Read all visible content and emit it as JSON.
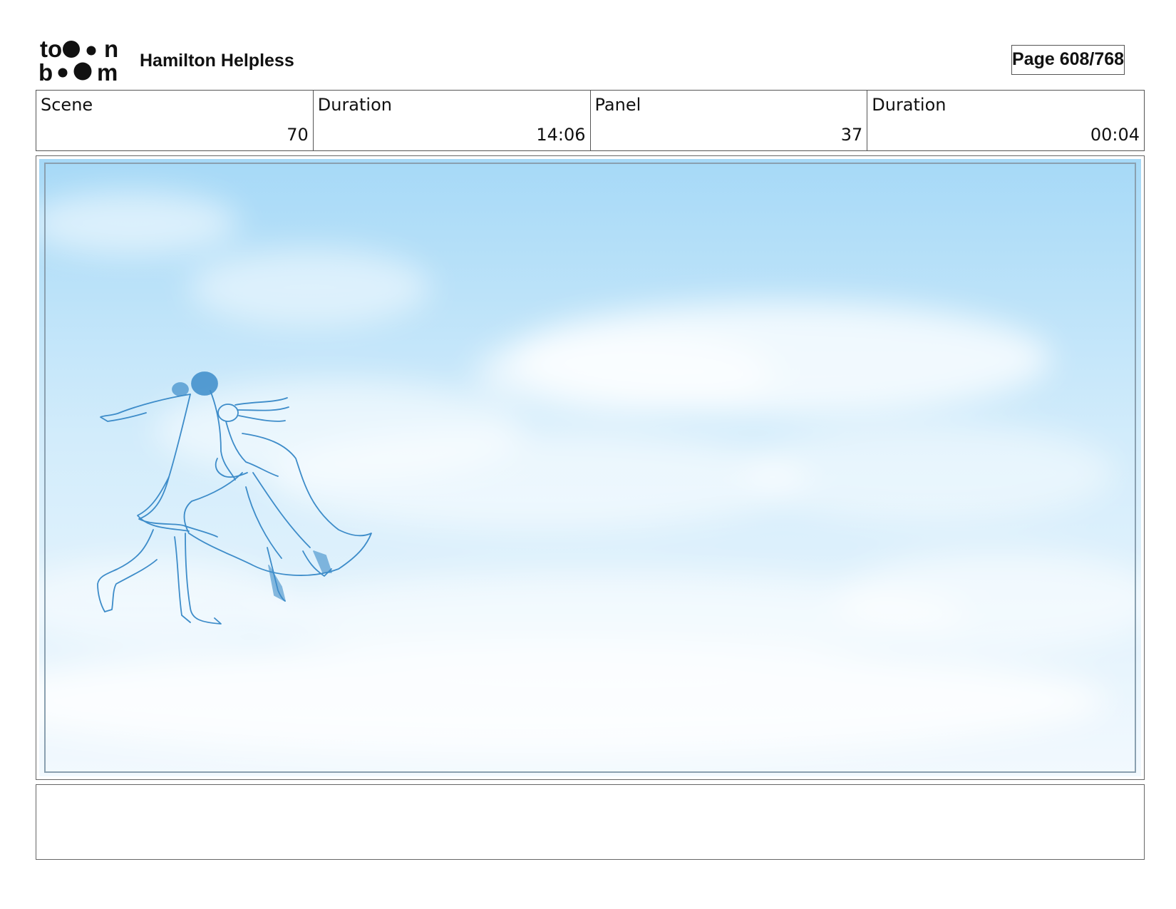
{
  "header": {
    "logo_text": [
      "to",
      "n",
      "b",
      "m"
    ],
    "title": "Hamilton Helpless",
    "page_indicator": "Page 608/768"
  },
  "info_table": [
    {
      "label": "Scene",
      "value": "70"
    },
    {
      "label": "Duration",
      "value": "14:06"
    },
    {
      "label": "Panel",
      "value": "37"
    },
    {
      "label": "Duration",
      "value": "00:04"
    }
  ],
  "panel": {
    "sky_colors": {
      "top": "#a6d9f7",
      "middle": "#d2ecfb",
      "bottom": "#f2f9fe"
    },
    "sketch_color": "#3d8cc9",
    "border_color": "#8aa0b0"
  },
  "dialogue": {
    "text": ""
  }
}
